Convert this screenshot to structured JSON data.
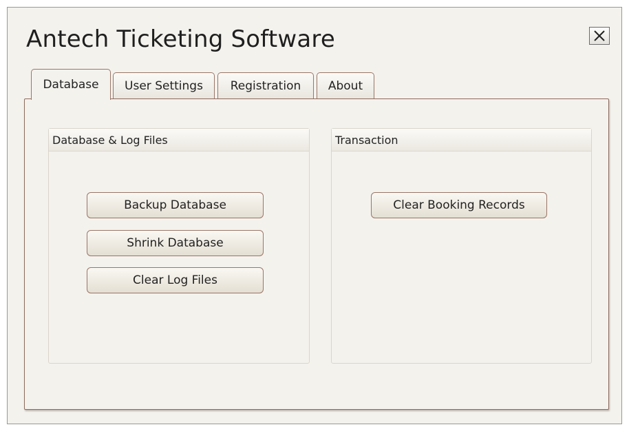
{
  "window": {
    "title": "Antech Ticketing Software",
    "close_label": "close"
  },
  "tabs": [
    {
      "label": "Database",
      "active": true
    },
    {
      "label": "User Settings",
      "active": false
    },
    {
      "label": "Registration",
      "active": false
    },
    {
      "label": "About",
      "active": false
    }
  ],
  "groups": {
    "database_log": {
      "title": "Database & Log Files",
      "buttons": [
        "Backup Database",
        "Shrink Database",
        "Clear Log Files"
      ]
    },
    "transaction": {
      "title": "Transaction",
      "buttons": [
        "Clear Booking Records"
      ]
    }
  },
  "colors": {
    "window_bg": "#f4f2ed",
    "accent_border": "#9a7466"
  }
}
